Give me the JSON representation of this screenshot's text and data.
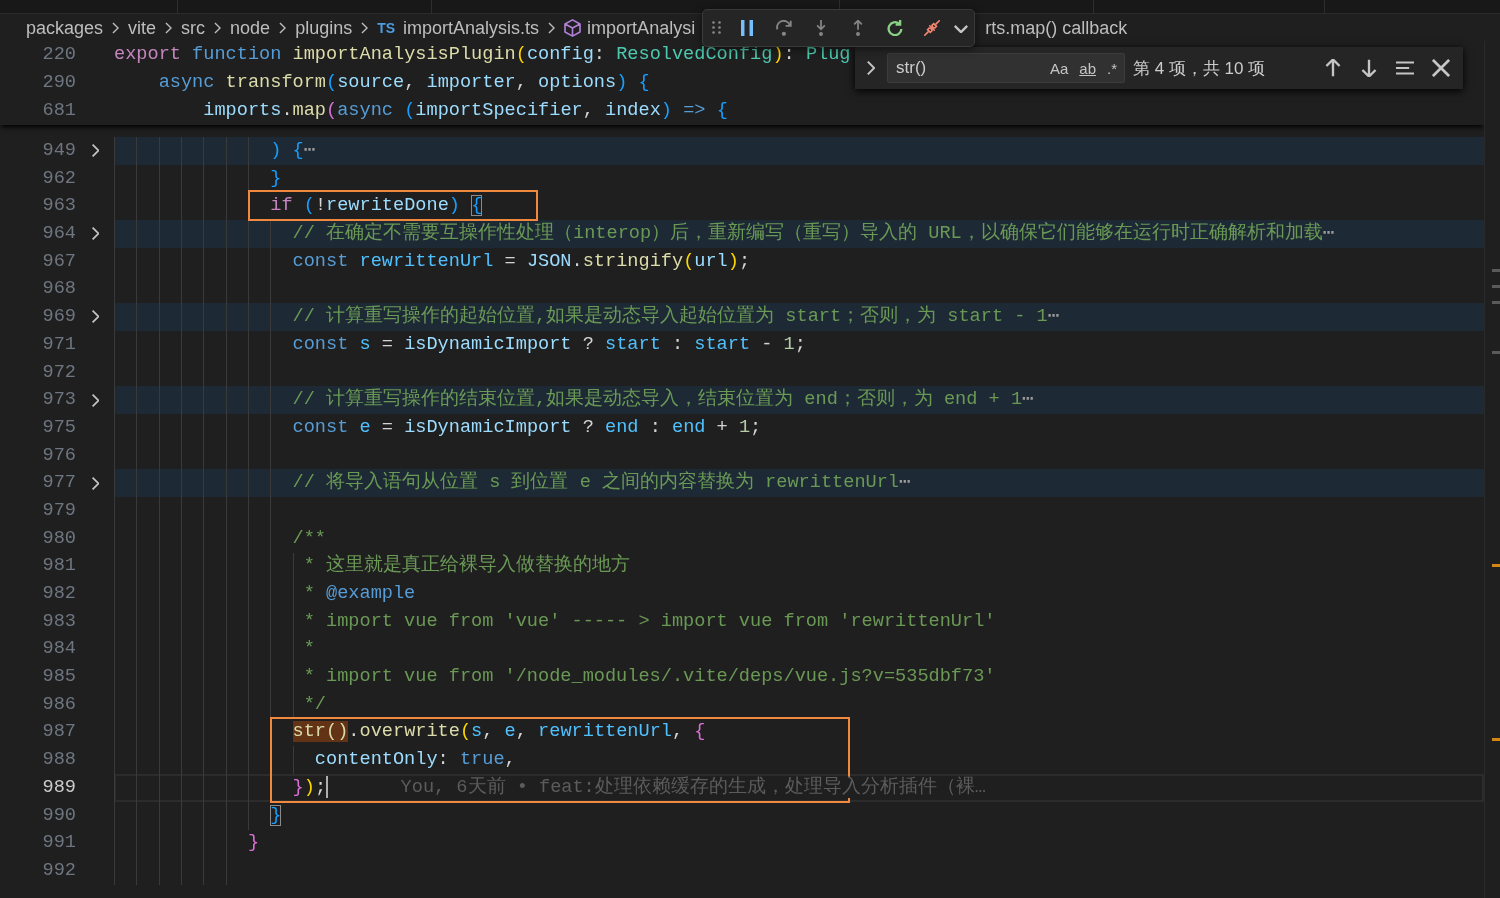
{
  "breadcrumbs": [
    {
      "kind": "folder",
      "label": "packages"
    },
    {
      "kind": "folder",
      "label": "vite"
    },
    {
      "kind": "folder",
      "label": "src"
    },
    {
      "kind": "folder",
      "label": "node"
    },
    {
      "kind": "folder",
      "label": "plugins"
    },
    {
      "kind": "file",
      "badge": "TS",
      "label": "importAnalysis.ts"
    },
    {
      "kind": "symbol",
      "label": "importAnalysi"
    },
    {
      "kind": "plain",
      "label": "rts.map() callback"
    }
  ],
  "debug_toolbar": {
    "buttons": [
      {
        "kind": "pause",
        "disabled": false
      },
      {
        "kind": "step-over",
        "disabled": true
      },
      {
        "kind": "step-into",
        "disabled": true
      },
      {
        "kind": "step-out",
        "disabled": true
      },
      {
        "kind": "restart",
        "disabled": false
      },
      {
        "kind": "disconnect",
        "disabled": false
      }
    ]
  },
  "find_widget": {
    "replace_expanded": false,
    "value": "str()",
    "options": [
      {
        "label": "Aa",
        "on": false
      },
      {
        "label": "ab",
        "on": false
      },
      {
        "label": ".*",
        "on": false
      }
    ],
    "match_count": "第 4 项，共 10 项"
  },
  "sticky_scroll": [
    {
      "number": "220",
      "tokens": [
        {
          "kind": "control",
          "text": "export "
        },
        {
          "kind": "keyword",
          "text": "function "
        },
        {
          "kind": "function",
          "text": "importAnalysisPlugin"
        },
        {
          "kind": "bracket-1",
          "text": "("
        },
        {
          "kind": "variable",
          "text": "config"
        },
        {
          "kind": "plain",
          "text": ": "
        },
        {
          "kind": "type",
          "text": "ResolvedConfig"
        },
        {
          "kind": "bracket-1",
          "text": ")"
        },
        {
          "kind": "plain",
          "text": ": "
        },
        {
          "kind": "type",
          "text": "Plug"
        }
      ]
    },
    {
      "number": "290",
      "tokens": [
        {
          "kind": "keyword",
          "text": "    async "
        },
        {
          "kind": "function",
          "text": "transform"
        },
        {
          "kind": "bracket-3",
          "text": "("
        },
        {
          "kind": "variable",
          "text": "source"
        },
        {
          "kind": "plain",
          "text": ", "
        },
        {
          "kind": "variable",
          "text": "importer"
        },
        {
          "kind": "plain",
          "text": ", "
        },
        {
          "kind": "variable",
          "text": "options"
        },
        {
          "kind": "bracket-3",
          "text": ") "
        },
        {
          "kind": "bracket-3",
          "text": "{"
        }
      ]
    },
    {
      "number": "681",
      "tokens": [
        {
          "kind": "variable",
          "text": "        imports"
        },
        {
          "kind": "plain",
          "text": "."
        },
        {
          "kind": "function",
          "text": "map"
        },
        {
          "kind": "bracket-2",
          "text": "("
        },
        {
          "kind": "keyword",
          "text": "async "
        },
        {
          "kind": "bracket-3",
          "text": "("
        },
        {
          "kind": "variable",
          "text": "importSpecifier"
        },
        {
          "kind": "plain",
          "text": ", "
        },
        {
          "kind": "variable",
          "text": "index"
        },
        {
          "kind": "bracket-3",
          "text": ")"
        },
        {
          "kind": "keyword",
          "text": " => "
        },
        {
          "kind": "bracket-3",
          "text": "{"
        }
      ]
    }
  ],
  "lines": [
    {
      "number": "949",
      "folded": true,
      "boxed": false,
      "current": false,
      "tokens": [
        {
          "kind": "bracket-3",
          "text": "              ) "
        },
        {
          "kind": "bracket-3",
          "text": "{"
        },
        {
          "kind": "fold-ellipsis",
          "text": "⋯"
        }
      ]
    },
    {
      "number": "962",
      "folded": false,
      "boxed": false,
      "current": false,
      "tokens": [
        {
          "kind": "bracket-3",
          "text": "              }"
        }
      ]
    },
    {
      "number": "963",
      "folded": false,
      "boxed": true,
      "current": false,
      "tokens": [
        {
          "kind": "control",
          "text": "              if "
        },
        {
          "kind": "bracket-3",
          "text": "("
        },
        {
          "kind": "plain",
          "text": "!"
        },
        {
          "kind": "variable",
          "text": "rewriteDone"
        },
        {
          "kind": "bracket-3",
          "text": ") "
        },
        {
          "kind": "bracket-match",
          "text": "{"
        }
      ]
    },
    {
      "number": "964",
      "folded": true,
      "boxed": false,
      "current": false,
      "tokens": [
        {
          "kind": "comment",
          "text": "                // 在确定不需要互操作性处理（interop）后，重新编写（重写）导入的 URL，以确保它们能够在运行时正确解析和加载"
        },
        {
          "kind": "fold-ellipsis",
          "text": "⋯"
        }
      ]
    },
    {
      "number": "967",
      "folded": false,
      "boxed": false,
      "current": false,
      "tokens": [
        {
          "kind": "keyword",
          "text": "                const "
        },
        {
          "kind": "constant",
          "text": "rewrittenUrl"
        },
        {
          "kind": "plain",
          "text": " = "
        },
        {
          "kind": "variable",
          "text": "JSON"
        },
        {
          "kind": "plain",
          "text": "."
        },
        {
          "kind": "function",
          "text": "stringify"
        },
        {
          "kind": "bracket-1",
          "text": "("
        },
        {
          "kind": "variable",
          "text": "url"
        },
        {
          "kind": "bracket-1",
          "text": ")"
        },
        {
          "kind": "plain",
          "text": ";"
        }
      ]
    },
    {
      "number": "968",
      "folded": false,
      "boxed": false,
      "current": false
    },
    {
      "number": "969",
      "folded": true,
      "boxed": false,
      "current": false,
      "tokens": [
        {
          "kind": "comment",
          "text": "                // 计算重写操作的起始位置,如果是动态导入起始位置为 start；否则，为 start - 1"
        },
        {
          "kind": "fold-ellipsis",
          "text": "⋯"
        }
      ]
    },
    {
      "number": "971",
      "folded": false,
      "boxed": false,
      "current": false,
      "tokens": [
        {
          "kind": "keyword",
          "text": "                const "
        },
        {
          "kind": "constant",
          "text": "s"
        },
        {
          "kind": "plain",
          "text": " = "
        },
        {
          "kind": "variable",
          "text": "isDynamicImport"
        },
        {
          "kind": "plain",
          "text": " ? "
        },
        {
          "kind": "constant",
          "text": "start"
        },
        {
          "kind": "plain",
          "text": " : "
        },
        {
          "kind": "constant",
          "text": "start"
        },
        {
          "kind": "plain",
          "text": " - "
        },
        {
          "kind": "number",
          "text": "1"
        },
        {
          "kind": "plain",
          "text": ";"
        }
      ]
    },
    {
      "number": "972",
      "folded": false,
      "boxed": false,
      "current": false
    },
    {
      "number": "973",
      "folded": true,
      "boxed": false,
      "current": false,
      "tokens": [
        {
          "kind": "comment",
          "text": "                // 计算重写操作的结束位置,如果是动态导入，结束位置为 end；否则，为 end + 1"
        },
        {
          "kind": "fold-ellipsis",
          "text": "⋯"
        }
      ]
    },
    {
      "number": "975",
      "folded": false,
      "boxed": false,
      "current": false,
      "tokens": [
        {
          "kind": "keyword",
          "text": "                const "
        },
        {
          "kind": "constant",
          "text": "e"
        },
        {
          "kind": "plain",
          "text": " = "
        },
        {
          "kind": "variable",
          "text": "isDynamicImport"
        },
        {
          "kind": "plain",
          "text": " ? "
        },
        {
          "kind": "constant",
          "text": "end"
        },
        {
          "kind": "plain",
          "text": " : "
        },
        {
          "kind": "constant",
          "text": "end"
        },
        {
          "kind": "plain",
          "text": " + "
        },
        {
          "kind": "number",
          "text": "1"
        },
        {
          "kind": "plain",
          "text": ";"
        }
      ]
    },
    {
      "number": "976",
      "folded": false,
      "boxed": false,
      "current": false
    },
    {
      "number": "977",
      "folded": true,
      "boxed": false,
      "current": false,
      "tokens": [
        {
          "kind": "comment",
          "text": "                // 将导入语句从位置 s 到位置 e 之间的内容替换为 rewrittenUrl"
        },
        {
          "kind": "fold-ellipsis",
          "text": "⋯"
        }
      ]
    },
    {
      "number": "979",
      "folded": false,
      "boxed": false,
      "current": false
    },
    {
      "number": "980",
      "folded": false,
      "boxed": false,
      "current": false,
      "tokens": [
        {
          "kind": "comment",
          "text": "                /**"
        }
      ]
    },
    {
      "number": "981",
      "folded": false,
      "boxed": false,
      "current": false,
      "tokens": [
        {
          "kind": "comment",
          "text": "                 * 这里就是真正给裸导入做替换的地方"
        }
      ]
    },
    {
      "number": "982",
      "folded": false,
      "boxed": false,
      "current": false,
      "tokens": [
        {
          "kind": "comment",
          "text": "                 * "
        },
        {
          "kind": "doc-tag",
          "text": "@example"
        }
      ]
    },
    {
      "number": "983",
      "folded": false,
      "boxed": false,
      "current": false,
      "tokens": [
        {
          "kind": "comment",
          "text": "                 * import vue from 'vue' ----- > import vue from 'rewrittenUrl'"
        }
      ]
    },
    {
      "number": "984",
      "folded": false,
      "boxed": false,
      "current": false,
      "tokens": [
        {
          "kind": "comment",
          "text": "                 *"
        }
      ]
    },
    {
      "number": "985",
      "folded": false,
      "boxed": false,
      "current": false,
      "tokens": [
        {
          "kind": "comment",
          "text": "                 * import vue from '/node_modules/.vite/deps/vue.js?v=535dbf73'"
        }
      ]
    },
    {
      "number": "986",
      "folded": false,
      "boxed": false,
      "current": false,
      "tokens": [
        {
          "kind": "comment",
          "text": "                 */"
        }
      ]
    },
    {
      "number": "987",
      "folded": false,
      "boxed": true,
      "current": false,
      "tokens": [
        {
          "kind": "find-match",
          "text": "                str()"
        },
        {
          "kind": "plain",
          "text": "."
        },
        {
          "kind": "function",
          "text": "overwrite"
        },
        {
          "kind": "bracket-1",
          "text": "("
        },
        {
          "kind": "constant",
          "text": "s"
        },
        {
          "kind": "plain",
          "text": ", "
        },
        {
          "kind": "constant",
          "text": "e"
        },
        {
          "kind": "plain",
          "text": ", "
        },
        {
          "kind": "constant",
          "text": "rewrittenUrl"
        },
        {
          "kind": "plain",
          "text": ", "
        },
        {
          "kind": "bracket-2",
          "text": "{"
        }
      ]
    },
    {
      "number": "988",
      "folded": false,
      "boxed": true,
      "current": false,
      "tokens": [
        {
          "kind": "variable",
          "text": "                  contentOnly"
        },
        {
          "kind": "plain",
          "text": ": "
        },
        {
          "kind": "keyword",
          "text": "true"
        },
        {
          "kind": "plain",
          "text": ","
        }
      ]
    },
    {
      "number": "989",
      "folded": false,
      "boxed": true,
      "current": true,
      "tokens": [
        {
          "kind": "bracket-2",
          "text": "                }"
        },
        {
          "kind": "bracket-1",
          "text": ")"
        },
        {
          "kind": "plain",
          "text": ";"
        }
      ],
      "blame": "You, 6天前 • feat:处理依赖缓存的生成，处理导入分析插件（裸…"
    },
    {
      "number": "990",
      "folded": false,
      "boxed": false,
      "current": false,
      "tokens": [
        {
          "kind": "bracket-match",
          "text": "              }"
        }
      ]
    },
    {
      "number": "991",
      "folded": false,
      "boxed": false,
      "current": false,
      "tokens": [
        {
          "kind": "bracket-2",
          "text": "            }"
        }
      ]
    },
    {
      "number": "992",
      "folded": false,
      "boxed": false,
      "current": false
    }
  ]
}
